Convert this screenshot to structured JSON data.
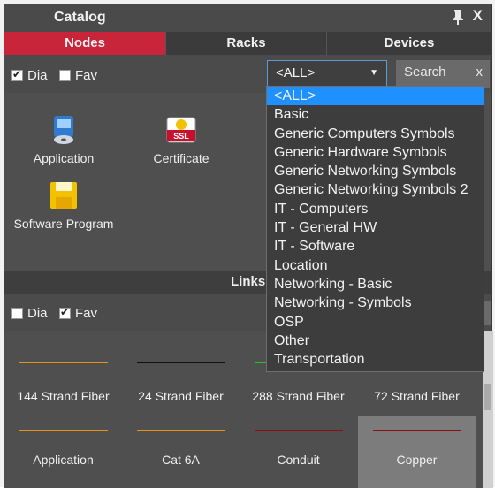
{
  "window": {
    "title": "Catalog",
    "close_label": "X"
  },
  "tabs": [
    {
      "label": "Nodes",
      "active": true
    },
    {
      "label": "Racks",
      "active": false
    },
    {
      "label": "Devices",
      "active": false
    }
  ],
  "filters": {
    "dia_label": "Dia",
    "dia_checked": true,
    "fav_label": "Fav",
    "fav_checked": false
  },
  "category_select": {
    "value": "<ALL>"
  },
  "search": {
    "placeholder": "Search",
    "clear_label": "x"
  },
  "nodes": [
    {
      "label": "Application",
      "icon": "application-icon"
    },
    {
      "label": "Certificate",
      "icon": "ssl-certificate-icon"
    },
    {
      "label": "Software Program",
      "icon": "floppy-disk-icon"
    }
  ],
  "links_section": {
    "title": "Links",
    "filters": {
      "dia_label": "Dia",
      "dia_checked": false,
      "fav_label": "Fav",
      "fav_checked": true
    },
    "items": [
      {
        "label": "144 Strand Fiber",
        "color": "#e8901a"
      },
      {
        "label": "24 Strand Fiber",
        "color": "#111111"
      },
      {
        "label": "288 Strand Fiber",
        "color": "#22c322"
      },
      {
        "label": "72 Strand Fiber",
        "color": "#cccccc"
      },
      {
        "label": "Application",
        "color": "#e8901a"
      },
      {
        "label": "Cat 6A",
        "color": "#e8901a"
      },
      {
        "label": "Conduit",
        "color": "#8a1010"
      },
      {
        "label": "Copper",
        "color": "#8a1010"
      }
    ]
  },
  "dropdown": {
    "options": [
      "<ALL>",
      "Basic",
      "Generic Computers Symbols",
      "Generic Hardware Symbols",
      "Generic Networking Symbols",
      "Generic Networking Symbols 2",
      "IT - Computers",
      "IT - General HW",
      "IT - Software",
      "Location",
      "Networking - Basic",
      "Networking - Symbols",
      "OSP",
      "Other",
      "Transportation"
    ],
    "highlighted": "<ALL>"
  }
}
